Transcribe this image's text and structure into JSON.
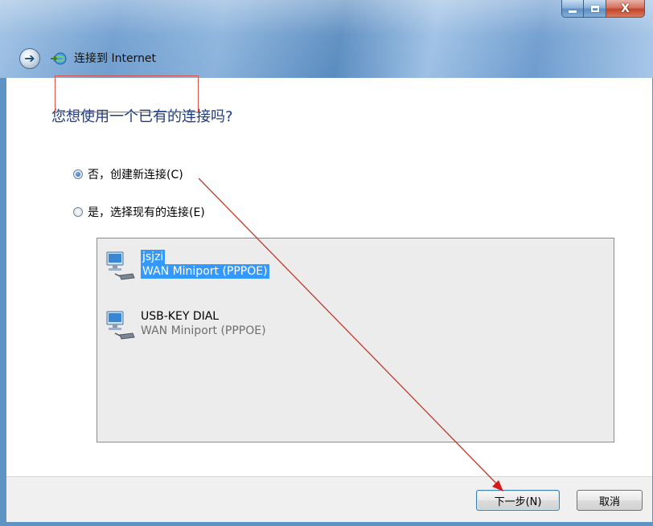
{
  "window": {
    "title": "连接到 Internet",
    "caption_buttons": {
      "minimize": "—",
      "maximize": "□",
      "close": "X"
    }
  },
  "main": {
    "heading": "您想使用一个已有的连接吗?",
    "options": [
      {
        "label": "否，创建新连接(C)",
        "selected": true
      },
      {
        "label": "是，选择现有的连接(E)",
        "selected": false
      }
    ],
    "connections": [
      {
        "name": "jsjzi",
        "type": "WAN Miniport (PPPOE)",
        "selected": true,
        "icon": "network-connection-icon"
      },
      {
        "name": "USB-KEY DIAL",
        "type": "WAN Miniport (PPPOE)",
        "selected": false,
        "icon": "network-connection-icon"
      }
    ]
  },
  "footer": {
    "next_label": "下一步(N)",
    "cancel_label": "取消"
  },
  "colors": {
    "heading": "#1d3a85",
    "selection": "#3399ff",
    "annotation": "#d9534a"
  }
}
